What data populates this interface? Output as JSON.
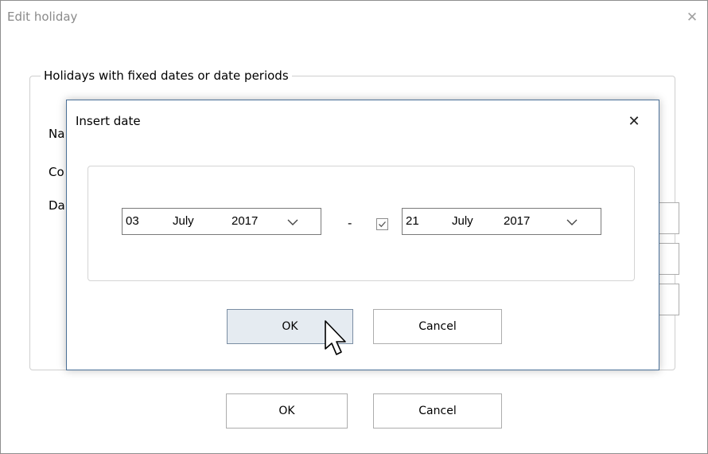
{
  "parent_window": {
    "title": "Edit holiday",
    "close_glyph": "✕",
    "group_title": "Holidays with fixed dates or date periods",
    "label_peeks": [
      "Na",
      "Co",
      "Da"
    ],
    "ok_label": "OK",
    "cancel_label": "Cancel"
  },
  "dialog": {
    "title": "Insert date",
    "close_glyph": "✕",
    "start_date": {
      "day": "03",
      "month": "July",
      "year": "2017"
    },
    "separator": "-",
    "end_date": {
      "day": "21",
      "month": "July",
      "year": "2017"
    },
    "end_date_enabled": true,
    "ok_label": "OK",
    "cancel_label": "Cancel"
  },
  "icons": {
    "close": "close-icon",
    "dropdown": "chevron-down-icon",
    "checkbox": "checkmark-icon",
    "cursor": "mouse-pointer-icon"
  },
  "colors": {
    "dialog_border": "#4a6f96",
    "ok_button_highlight": "#e5ebf1",
    "disabled_title": "#8a8a8a"
  }
}
